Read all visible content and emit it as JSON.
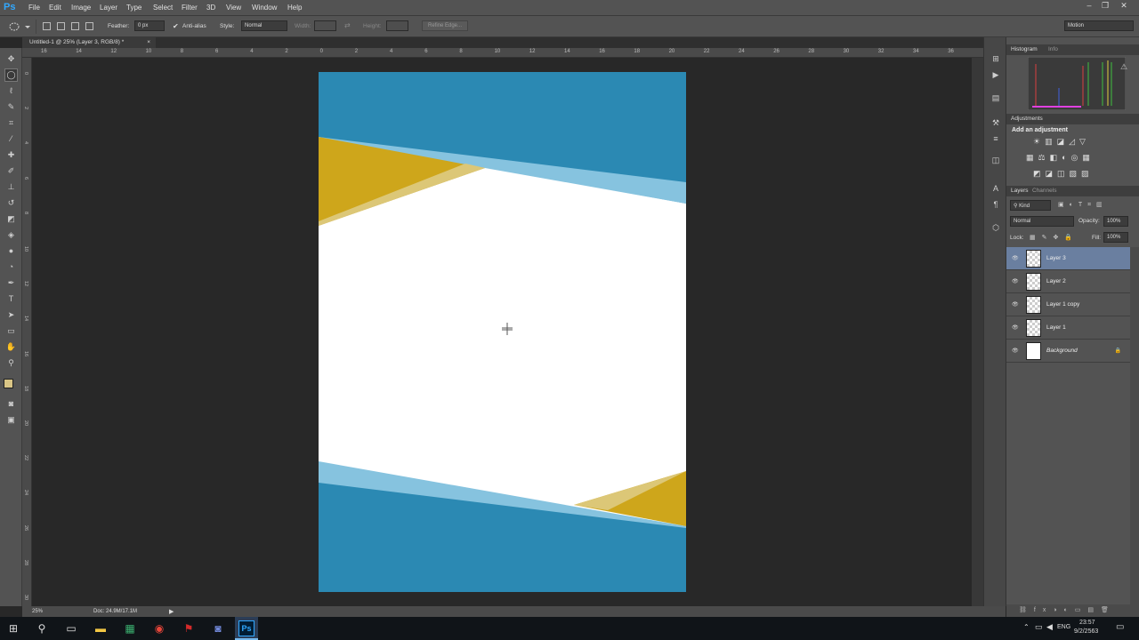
{
  "app": {
    "logo": "Ps"
  },
  "menu": [
    "File",
    "Edit",
    "Image",
    "Layer",
    "Type",
    "Select",
    "Filter",
    "3D",
    "View",
    "Window",
    "Help"
  ],
  "workspace": "Motion",
  "options": {
    "feather_label": "Feather:",
    "feather_value": "0 px",
    "antialias_label": "Anti-alias",
    "style_label": "Style:",
    "style_value": "Normal",
    "width_label": "Width:",
    "height_label": "Height:",
    "refine_label": "Refine Edge..."
  },
  "document": {
    "tab_title": "Untitled-1 @ 25% (Layer 3, RGB/8) *"
  },
  "ruler": {
    "top": [
      "16",
      "14",
      "12",
      "10",
      "8",
      "6",
      "4",
      "2",
      "0",
      "2",
      "4",
      "6",
      "8",
      "10",
      "12",
      "14",
      "16",
      "18",
      "20",
      "22",
      "24",
      "26",
      "28",
      "30",
      "32",
      "34",
      "36"
    ],
    "left": [
      "0",
      "2",
      "4",
      "6",
      "8",
      "1\n0",
      "1\n2",
      "1\n4",
      "1\n6",
      "1\n8",
      "2\n0",
      "2\n2",
      "2\n4",
      "2\n6",
      "2\n8",
      "3\n0"
    ]
  },
  "colors": {
    "blue": "#2b89b3",
    "light_blue": "#86c3df",
    "gold": "#cea61b",
    "gold_light": "#dcc777",
    "foreground": "#d9c586",
    "background": "#ffffff"
  },
  "panels": {
    "histogram_tab": "Histogram",
    "info_tab": "Info",
    "adjustments_tab": "Adjustments",
    "adjustments_title": "Add an adjustment",
    "layers_tab": "Layers",
    "channels_tab": "Channels",
    "kind_label": "Kind",
    "blend_mode": "Normal",
    "opacity_label": "Opacity:",
    "opacity_value": "100%",
    "lock_label": "Lock:",
    "fill_label": "Fill:",
    "fill_value": "100%"
  },
  "layers": [
    {
      "name": "Layer 3",
      "selected": true,
      "locked": false
    },
    {
      "name": "Layer 2",
      "selected": false,
      "locked": false
    },
    {
      "name": "Layer 1 copy",
      "selected": false,
      "locked": false
    },
    {
      "name": "Layer 1",
      "selected": false,
      "locked": false
    },
    {
      "name": "Background",
      "selected": false,
      "locked": true
    }
  ],
  "status": {
    "zoom": "25%",
    "doc": "Doc: 24.9M/17.1M"
  },
  "taskbar": {
    "lang": "ENG",
    "time": "23:57",
    "date": "9/2/2563"
  }
}
